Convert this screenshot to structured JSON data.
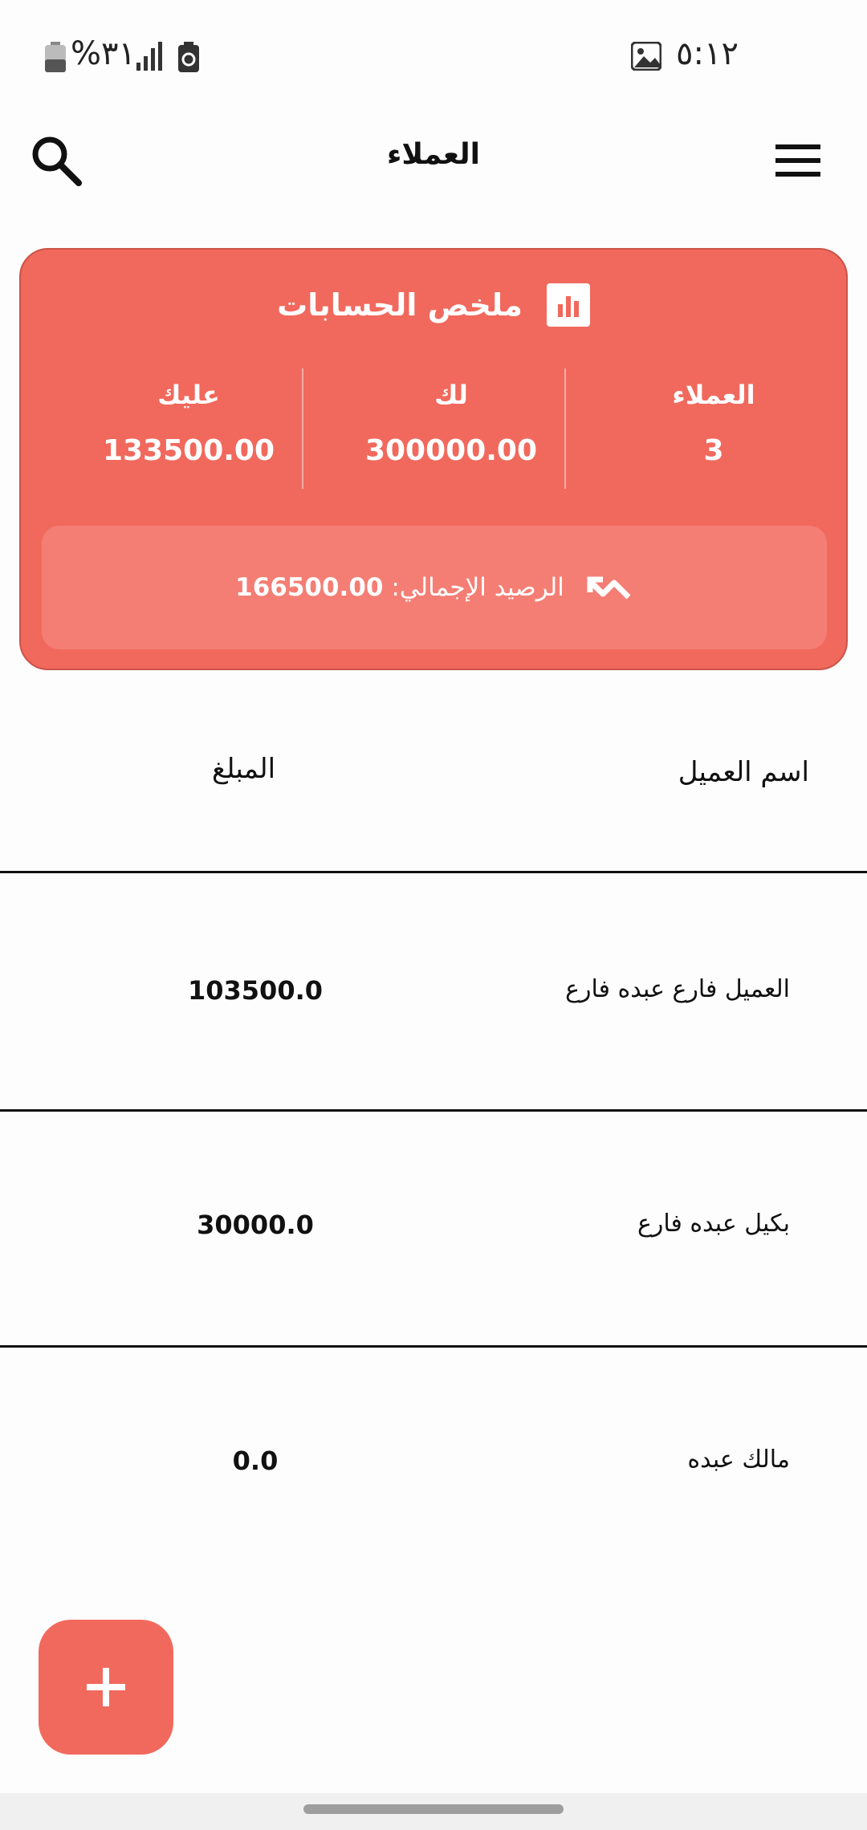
{
  "status_bar": {
    "time": "٥:١٢",
    "battery_percent": "%٣١"
  },
  "app_bar": {
    "title": "العملاء"
  },
  "summary": {
    "title": "ملخص الحسابات",
    "stats": [
      {
        "label": "العملاء",
        "value": "3"
      },
      {
        "label": "لك",
        "value": "300000.00"
      },
      {
        "label": "عليك",
        "value": "133500.00"
      }
    ],
    "balance_label": "الرصيد الإجمالي: ",
    "balance_value": "166500.00"
  },
  "table": {
    "headers": {
      "name": "اسم العميل",
      "amount": "المبلغ"
    },
    "rows": [
      {
        "name": "العميل فارع عبده فارع",
        "amount": "103500.0"
      },
      {
        "name": "بكيل عبده فارع",
        "amount": "30000.0"
      },
      {
        "name": "مالك عبده",
        "amount": "0.0"
      }
    ]
  },
  "fab": {
    "icon": "plus-icon"
  },
  "colors": {
    "accent": "#f1695d",
    "accent_light": "#f47e74"
  }
}
